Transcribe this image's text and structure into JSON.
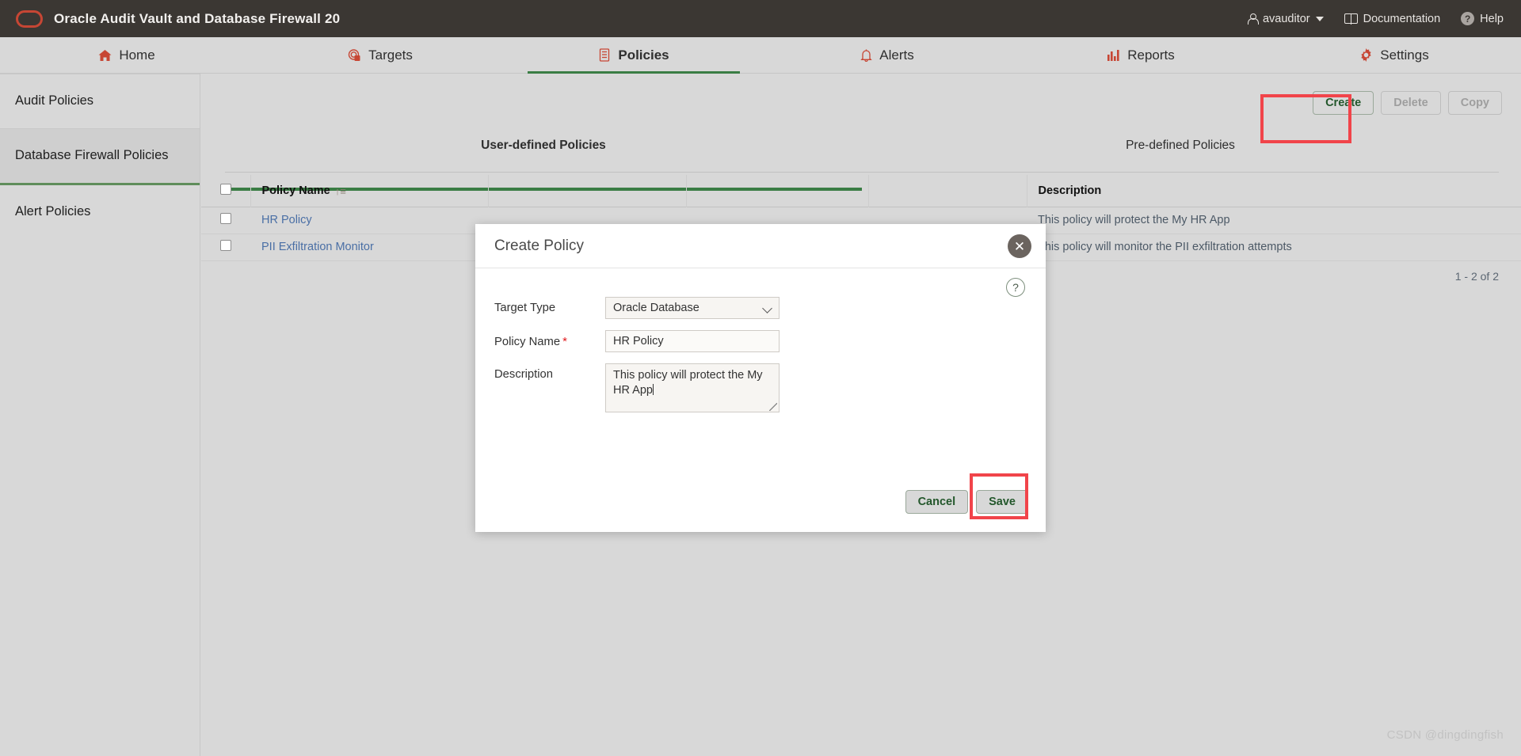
{
  "brand": {
    "logo_icon": "oracle-logo-icon",
    "title": "Oracle Audit Vault and Database Firewall 20",
    "user": "avauditor",
    "user_icon": "person-icon",
    "caret_icon": "chevron-down-icon",
    "documentation": "Documentation",
    "documentation_icon": "book-icon",
    "help": "Help",
    "help_icon": "question-circle-icon",
    "bar_color": "#3b3733",
    "accent_color": "#c74634"
  },
  "nav": {
    "items": [
      {
        "label": "Home",
        "icon": "home-icon",
        "active": false
      },
      {
        "label": "Targets",
        "icon": "target-icon",
        "active": false
      },
      {
        "label": "Policies",
        "icon": "policy-document-icon",
        "active": true
      },
      {
        "label": "Alerts",
        "icon": "bell-icon",
        "active": false
      },
      {
        "label": "Reports",
        "icon": "bar-chart-icon",
        "active": false
      },
      {
        "label": "Settings",
        "icon": "gear-icon",
        "active": false
      }
    ],
    "active_underline_color": "#3a7d44"
  },
  "sidebar": {
    "items": [
      {
        "label": "Audit Policies",
        "selected": false
      },
      {
        "label": "Database Firewall Policies",
        "selected": true
      },
      {
        "label": "Alert Policies",
        "selected": false
      }
    ]
  },
  "toolbar": {
    "create_label": "Create",
    "delete_label": "Delete",
    "copy_label": "Copy",
    "highlight_color": "#f1444a"
  },
  "tabs": [
    {
      "label": "User-defined Policies",
      "active": true
    },
    {
      "label": "Pre-defined Policies",
      "active": false
    }
  ],
  "table": {
    "headers": {
      "checkbox": "",
      "policy_name": "Policy Name",
      "sort_icon": "sort-ascending-icon",
      "col3": "",
      "col4": "",
      "col5": "",
      "description": "Description"
    },
    "rows": [
      {
        "policy_name": "HR Policy",
        "description": "This policy will protect the My HR App"
      },
      {
        "policy_name": "PII Exfiltration Monitor",
        "description": "This policy will monitor the PII exfiltration attempts"
      }
    ],
    "pagination": "1 - 2 of 2"
  },
  "modal": {
    "title": "Create Policy",
    "close_icon": "close-icon",
    "help_icon": "question-mark-icon",
    "help_symbol": "?",
    "fields": {
      "target_type_label": "Target Type",
      "target_type_value": "Oracle Database",
      "target_type_chevron": "chevron-down-icon",
      "policy_name_label": "Policy Name",
      "policy_name_required": "*",
      "policy_name_value": "HR Policy",
      "description_label": "Description",
      "description_value": "This policy will protect the My HR App"
    },
    "cancel_label": "Cancel",
    "save_label": "Save"
  },
  "watermark": "CSDN @dingdingfish"
}
